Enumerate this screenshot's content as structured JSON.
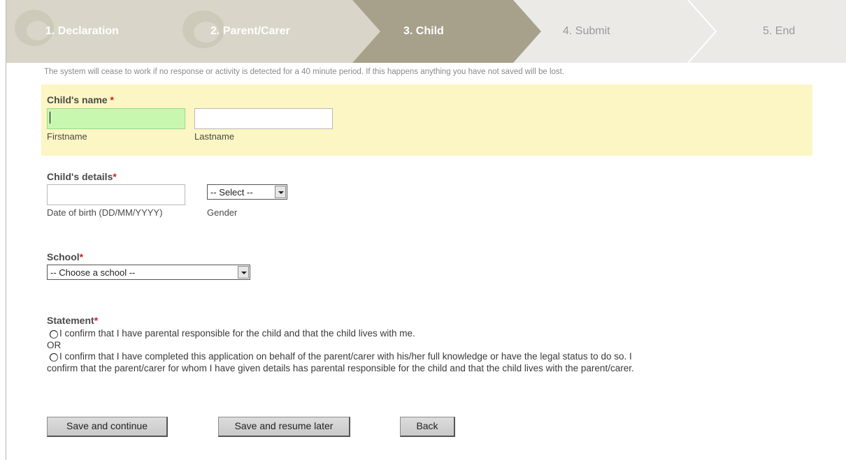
{
  "steps": [
    {
      "label": "1. Declaration",
      "state": "done"
    },
    {
      "label": "2. Parent/Carer",
      "state": "done"
    },
    {
      "label": "3. Child",
      "state": "current"
    },
    {
      "label": "4. Submit",
      "state": "todo"
    },
    {
      "label": "5. End",
      "state": "todo"
    }
  ],
  "notice": "The system will cease to work if no response or activity is detected for a 40 minute period. If this happens anything you have not saved will be lost.",
  "childs_name": {
    "label": "Child's name",
    "required_mark": "*",
    "firstname_value": "",
    "firstname_caption": "Firstname",
    "lastname_value": "",
    "lastname_caption": "Lastname"
  },
  "childs_details": {
    "label": "Child's details",
    "required_mark": "*",
    "dob_value": "",
    "dob_caption": "Date of birth (DD/MM/YYYY)",
    "gender_selected": "-- Select --",
    "gender_caption": "Gender"
  },
  "school": {
    "label": "School",
    "required_mark": "*",
    "selected": "-- Choose a school --"
  },
  "statement": {
    "label": "Statement",
    "required_mark": "*",
    "option1": "I confirm that I have parental responsible for the child and that the child lives with me.",
    "or_text": "OR",
    "option2_line1": "I confirm that I have completed this application on behalf of the parent/carer with his/her full knowledge or have the legal status to do so. I",
    "option2_line2": "confirm that the parent/carer for whom I have given details has parental responsible for the child and that the child lives with the parent/carer."
  },
  "buttons": {
    "save_continue": "Save and continue",
    "save_resume": "Save and resume later",
    "back": "Back"
  },
  "colors": {
    "done_step_bg": "#dcd8cc",
    "current_step_bg": "#a8a28c",
    "todo_step_bg": "#ececea",
    "name_panel_bg": "#fbf6c3",
    "focused_input_bg": "#c8f7b0",
    "required": "#cc2222"
  }
}
